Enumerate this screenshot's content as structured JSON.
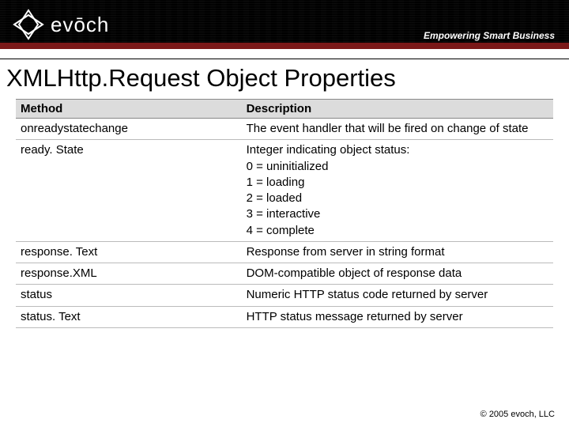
{
  "header": {
    "brand": "evōch",
    "tagline": "Empowering Smart Business"
  },
  "title": "XMLHttp.Request Object Properties",
  "table": {
    "headers": {
      "method": "Method",
      "description": "Description"
    },
    "rows": [
      {
        "method": "onreadystatechange",
        "description": "The event handler that will be fired on change of state"
      },
      {
        "method": "ready. State",
        "description": "Integer indicating object status:\n0 = uninitialized\n1 = loading\n2 = loaded\n3 = interactive\n4 = complete"
      },
      {
        "method": "response. Text",
        "description": "Response from server in string format"
      },
      {
        "method": "response.XML",
        "description": "DOM-compatible object of response data"
      },
      {
        "method": "status",
        "description": "Numeric HTTP status code returned by server"
      },
      {
        "method": "status. Text",
        "description": "HTTP status message returned by server"
      }
    ]
  },
  "footer": "© 2005  evoch, LLC"
}
